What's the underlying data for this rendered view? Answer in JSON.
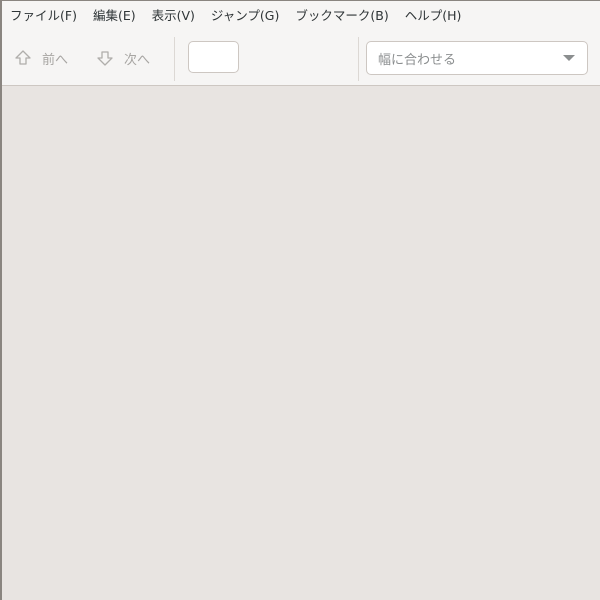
{
  "menubar": {
    "items": [
      {
        "label": "ファイル(F)"
      },
      {
        "label": "編集(E)"
      },
      {
        "label": "表示(V)"
      },
      {
        "label": "ジャンプ(G)"
      },
      {
        "label": "ブックマーク(B)"
      },
      {
        "label": "ヘルプ(H)"
      }
    ]
  },
  "toolbar": {
    "prev_label": "前へ",
    "next_label": "次へ",
    "page_entry_value": "",
    "zoom_value": "幅に合わせる"
  },
  "icons": {
    "prev": "go-up-icon",
    "next": "go-down-icon",
    "zoom_dropdown": "chevron-down-icon"
  }
}
